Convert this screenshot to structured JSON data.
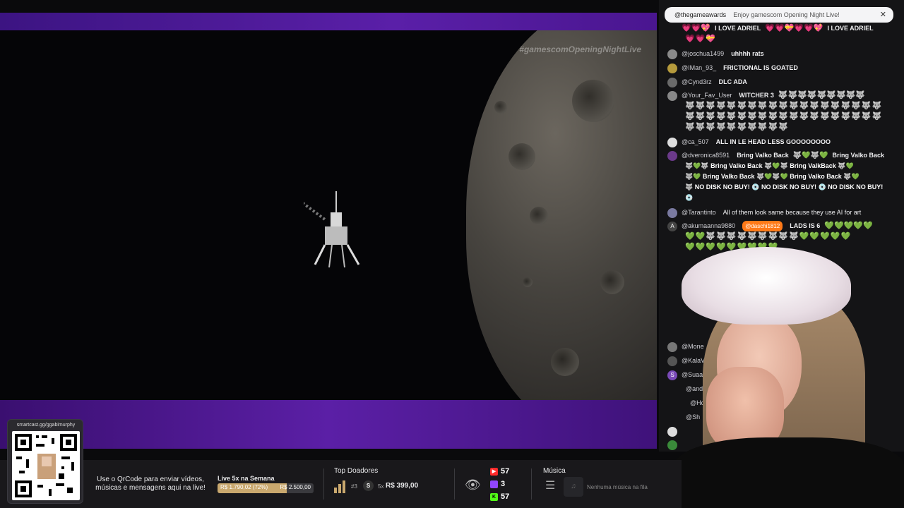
{
  "video": {
    "hashtag": "#gamescomOpeningNightLive"
  },
  "chat": {
    "header": {
      "user": "@thegameawards",
      "text": "Enjoy gamescom Opening Night Live!",
      "close_icon": "close-icon"
    },
    "messages": [
      {
        "user": "",
        "text": "I LOVE ADRIEL",
        "extra": "I LOVE ADRIEL",
        "avatar_color": "#555"
      },
      {
        "user": "@joschua1499",
        "text": "uhhhh rats",
        "avatar_color": "#8a8a8a"
      },
      {
        "user": "@IMan_93_",
        "text": "FRICTIONAL IS GOATED",
        "avatar_color": "#b59a3c"
      },
      {
        "user": "@Cynd3rz",
        "text": "DLC ADA",
        "avatar_color": "#6a6a6a"
      },
      {
        "user": "@Your_Fav_User",
        "text": "WITCHER 3",
        "avatar_color": "#888"
      },
      {
        "user": "@ca_507",
        "text": "ALL IN LE HEAD LESS GOOOOOOOO",
        "avatar_color": "#ddd"
      },
      {
        "user": "@dveronica8591",
        "text": "Bring Valko Back",
        "t2": "Bring Valko Back",
        "t3": "Bring Valko Back",
        "t4": "Bring ValkBack",
        "t5": "Bring Valko Back",
        "t6": "Bring Valko Back",
        "t7": "NO DISK NO BUY!",
        "t8": "NO DISK NO BUY!",
        "t9": "NO DISK NO BUY!",
        "avatar_color": "#6b3a8a"
      },
      {
        "user": "@Tarantinto",
        "text": "All of them look same because they use AI for art",
        "avatar_color": "#7a7aa0"
      },
      {
        "user": "@akumaanna9880",
        "mention": "@daschi1812",
        "text": "LADS IS 6",
        "avatar_color": "#444",
        "avatar_letter": "A"
      }
    ],
    "partial_users": [
      "@Mone",
      "@KalaVe",
      "@Suaatar",
      "@andrew",
      "@Hod",
      "@Sh"
    ]
  },
  "bottom_bar": {
    "qr_url": "smartcast.gg/ggabimurphy",
    "qr_help": "Use o QrCode para enviar vídeos, músicas e mensagens aqui na live!",
    "goal_title": "Live 5x na Semana",
    "goal_current": "R$ 1.790,02 (72%)",
    "goal_total": "R$ 2.500,00",
    "goal_fraction": 0.72,
    "top_donors_title": "Top Doadores",
    "donor_rank": "#3",
    "donor_initial": "S",
    "donor_multiplier": "5x",
    "donor_amount": "R$ 399,00",
    "viewers_youtube": "57",
    "viewers_twitch": "3",
    "viewers_kick": "57",
    "music_title": "Música",
    "music_none": "Nenhuma música na fila"
  }
}
